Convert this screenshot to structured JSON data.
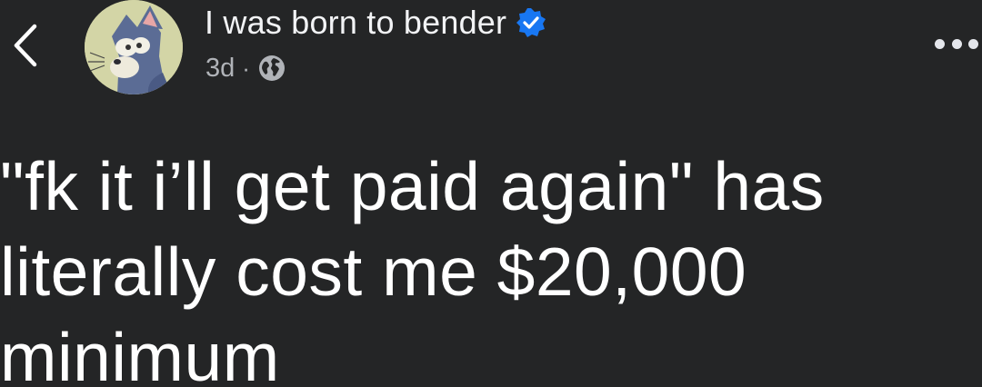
{
  "post": {
    "author_name": "I was born to bender",
    "verified": true,
    "time": "3d",
    "separator": "·",
    "audience_icon": "globe-icon",
    "text": "\"fk it i’ll get paid again\" has literally cost me $20,000 minimum"
  },
  "nav": {
    "back_icon": "chevron-left-icon",
    "more_icon": "more-horizontal-icon"
  },
  "colors": {
    "background": "#242526",
    "primary_text": "#ffffff",
    "secondary_text": "#b0b3b8",
    "verified_blue": "#1877f2"
  }
}
